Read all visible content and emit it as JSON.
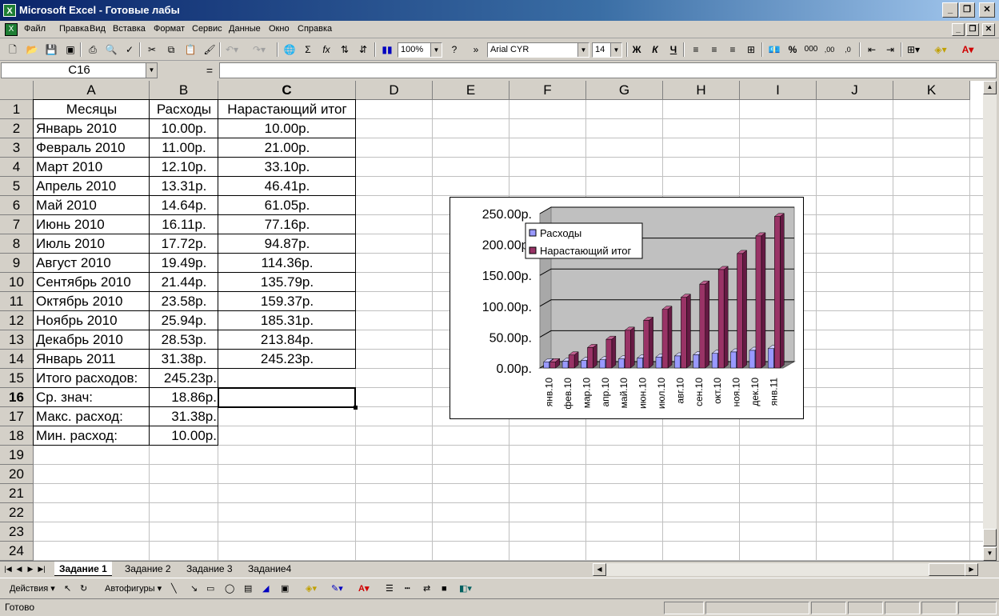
{
  "window": {
    "title": "Microsoft Excel - Готовые лабы"
  },
  "menu": [
    "Файл",
    "Правка",
    "Вид",
    "Вставка",
    "Формат",
    "Сервис",
    "Данные",
    "Окно",
    "Справка"
  ],
  "toolbar": {
    "zoom": "100%",
    "font_name": "Arial CYR",
    "font_size": "14",
    "bold": "Ж",
    "italic": "К",
    "underline": "Ч",
    "sigma": "Σ",
    "fx": "fx",
    "percent": "%",
    "thousands": "000",
    "inc_dec": ",00",
    "dec_dec": ",0"
  },
  "formula_bar": {
    "name_box": "C16",
    "equals": "=",
    "value": ""
  },
  "columns": [
    "A",
    "B",
    "C",
    "D",
    "E",
    "F",
    "G",
    "H",
    "I",
    "J",
    "K"
  ],
  "rows": [
    "1",
    "2",
    "3",
    "4",
    "5",
    "6",
    "7",
    "8",
    "9",
    "10",
    "11",
    "12",
    "13",
    "14",
    "15",
    "16",
    "17",
    "18",
    "19",
    "20",
    "21",
    "22",
    "23",
    "24"
  ],
  "table": {
    "headers": [
      "Месяцы",
      "Расходы",
      "Нарастающий итог"
    ],
    "data": [
      [
        "Январь 2010",
        "10.00р.",
        "10.00р."
      ],
      [
        "Февраль 2010",
        "11.00р.",
        "21.00р."
      ],
      [
        "Март 2010",
        "12.10р.",
        "33.10р."
      ],
      [
        "Апрель 2010",
        "13.31р.",
        "46.41р."
      ],
      [
        "Май 2010",
        "14.64р.",
        "61.05р."
      ],
      [
        "Июнь 2010",
        "16.11р.",
        "77.16р."
      ],
      [
        "Июль 2010",
        "17.72р.",
        "94.87р."
      ],
      [
        "Август 2010",
        "19.49р.",
        "114.36р."
      ],
      [
        "Сентябрь 2010",
        "21.44р.",
        "135.79р."
      ],
      [
        "Октябрь 2010",
        "23.58р.",
        "159.37р."
      ],
      [
        "Ноябрь 2010",
        "25.94р.",
        "185.31р."
      ],
      [
        "Декабрь 2010",
        "28.53р.",
        "213.84р."
      ],
      [
        "Январь 2011",
        "31.38р.",
        "245.23р."
      ]
    ],
    "summary": [
      [
        "Итого расходов:",
        "245.23р."
      ],
      [
        "Ср. знач:",
        "18.86р."
      ],
      [
        "Макс. расход:",
        "31.38р."
      ],
      [
        "Мин. расход:",
        "10.00р."
      ]
    ]
  },
  "chart_data": {
    "type": "bar",
    "categories": [
      "янв.10",
      "фев.10",
      "мар.10",
      "апр.10",
      "май.10",
      "июн.10",
      "июл.10",
      "авг.10",
      "сен.10",
      "окт.10",
      "ноя.10",
      "дек.10",
      "янв.11"
    ],
    "series": [
      {
        "name": "Расходы",
        "values": [
          10.0,
          11.0,
          12.1,
          13.31,
          14.64,
          16.11,
          17.72,
          19.49,
          21.44,
          23.58,
          25.94,
          28.53,
          31.38
        ],
        "color": "#9999ff"
      },
      {
        "name": "Нарастающий итог",
        "values": [
          10.0,
          21.0,
          33.1,
          46.41,
          61.05,
          77.16,
          94.87,
          114.36,
          135.79,
          159.37,
          185.31,
          213.84,
          245.23
        ],
        "color": "#993366"
      }
    ],
    "ylim": [
      0,
      250
    ],
    "yticks": [
      "0.00р.",
      "50.00р.",
      "100.00р.",
      "150.00р.",
      "200.00р.",
      "250.00р."
    ],
    "legend_position": "top-left",
    "grid": true,
    "style": "3d"
  },
  "sheet_tabs": [
    "Задание 1",
    "Задание 2",
    "Задание 3",
    "Задание4"
  ],
  "active_tab": "Задание 1",
  "drawing": {
    "actions": "Действия",
    "autoshapes": "Автофигуры"
  },
  "status": {
    "text": "Готово"
  }
}
